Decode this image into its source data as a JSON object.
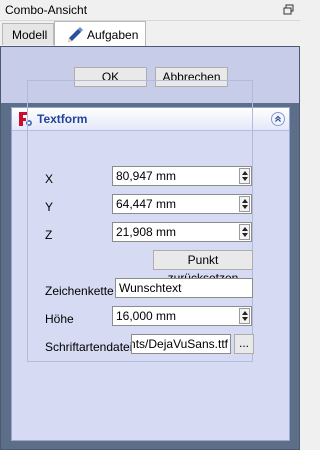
{
  "window": {
    "title": "Combo-Ansicht"
  },
  "tabs": [
    {
      "label": "Modell",
      "active": false
    },
    {
      "label": "Aufgaben",
      "active": true
    }
  ],
  "dialog": {
    "ok_label": "OK",
    "cancel_label": "Abbrechen"
  },
  "task": {
    "title": "Textform",
    "fields": {
      "x": {
        "label": "X",
        "value": "80,947 mm"
      },
      "y": {
        "label": "Y",
        "value": "64,447 mm"
      },
      "z": {
        "label": "Z",
        "value": "21,908 mm"
      },
      "reset_label": "Punkt zurücksetzen",
      "string": {
        "label": "Zeichenkette",
        "value": "Wunschtext"
      },
      "height": {
        "label": "Höhe",
        "value": "16,000 mm"
      },
      "font_file": {
        "label": "Schriftartendatei",
        "value": "nts/DejaVuSans.ttf"
      },
      "browse_label": "..."
    }
  },
  "colors": {
    "panel_bg": "#5d6f88",
    "box_bg": "#d6dbf3",
    "header_title": "#21449a",
    "icon_red": "#c8102e"
  }
}
